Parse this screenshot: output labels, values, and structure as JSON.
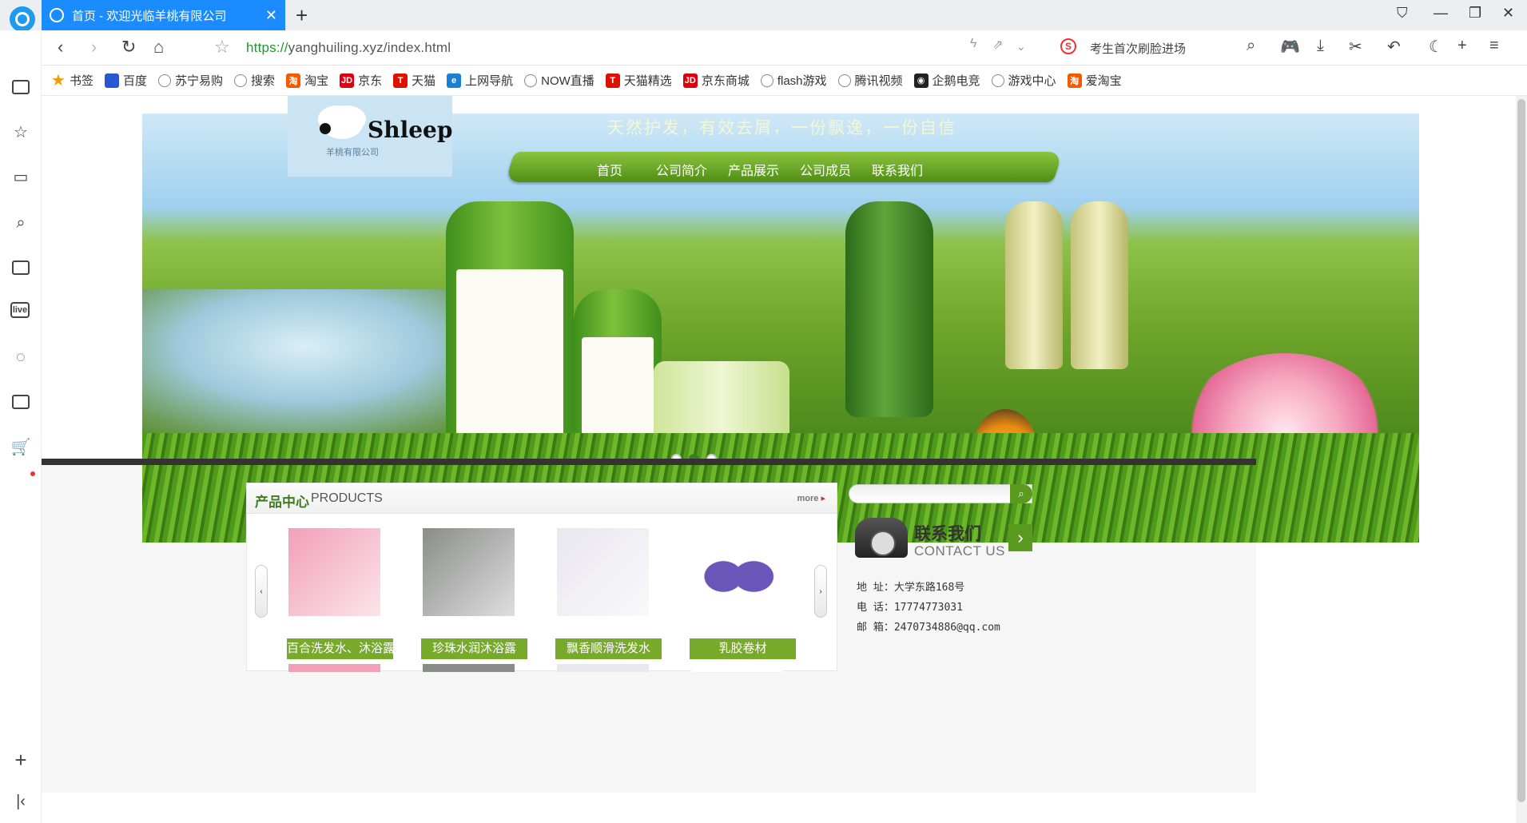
{
  "browser": {
    "tab_title": "首页 - 欢迎光临羊桃有限公司",
    "url_scheme": "https://",
    "url_rest": "yanghuiling.xyz/index.html",
    "search_hint": "考生首次刷脸进场",
    "search_engine_letter": "S"
  },
  "bookmarks": [
    {
      "label": "书签",
      "icon": "star-icon"
    },
    {
      "label": "百度",
      "icon": "baidu-icon"
    },
    {
      "label": "苏宁易购",
      "icon": "globe-icon"
    },
    {
      "label": "搜索",
      "icon": "globe-icon"
    },
    {
      "label": "淘宝",
      "icon": "taobao-icon"
    },
    {
      "label": "京东",
      "icon": "jd-icon"
    },
    {
      "label": "天猫",
      "icon": "tmall-icon"
    },
    {
      "label": "上网导航",
      "icon": "ie-icon"
    },
    {
      "label": "NOW直播",
      "icon": "globe-icon"
    },
    {
      "label": "天猫精选",
      "icon": "tmall-icon"
    },
    {
      "label": "京东商城",
      "icon": "jd-icon"
    },
    {
      "label": "flash游戏",
      "icon": "globe-icon"
    },
    {
      "label": "腾讯视频",
      "icon": "globe-icon"
    },
    {
      "label": "企鹅电竞",
      "icon": "penguin-icon"
    },
    {
      "label": "游戏中心",
      "icon": "globe-icon"
    },
    {
      "label": "爱淘宝",
      "icon": "taobao-icon"
    }
  ],
  "site": {
    "logo_text": "Shleep",
    "logo_sub": "羊桃有限公司",
    "banner_slogan": "天然护发，有效去屑，一份飘逸，一份自信",
    "nav": [
      "首页",
      "公司简介",
      "产品展示",
      "公司成员",
      "联系我们"
    ],
    "carousel_active": 2,
    "carousel_count": 3
  },
  "products": {
    "title_cn": "产品中心",
    "title_en": "PRODUCTS",
    "more": "more",
    "items": [
      {
        "name": "百合洗发水、沐浴露套",
        "color": "#f2a0b8"
      },
      {
        "name": "珍珠水润沐浴露",
        "color": "#8a8c8a"
      },
      {
        "name": "飘香顺滑洗发水",
        "color": "#e9e7ef"
      },
      {
        "name": "乳胶卷材",
        "color": "#ffffff"
      }
    ],
    "prev": "‹",
    "next": "›"
  },
  "contact": {
    "title_cn": "联系我们",
    "title_en": "CONTACT US",
    "address": "地 址：大学东路168号",
    "phone": "电 话：17774773031",
    "email": "邮 箱：2470734886@qq.com"
  },
  "colors": {
    "accent": "#1a8cff",
    "brand_green": "#77a92a",
    "nav_green": "#5a9a1e"
  }
}
